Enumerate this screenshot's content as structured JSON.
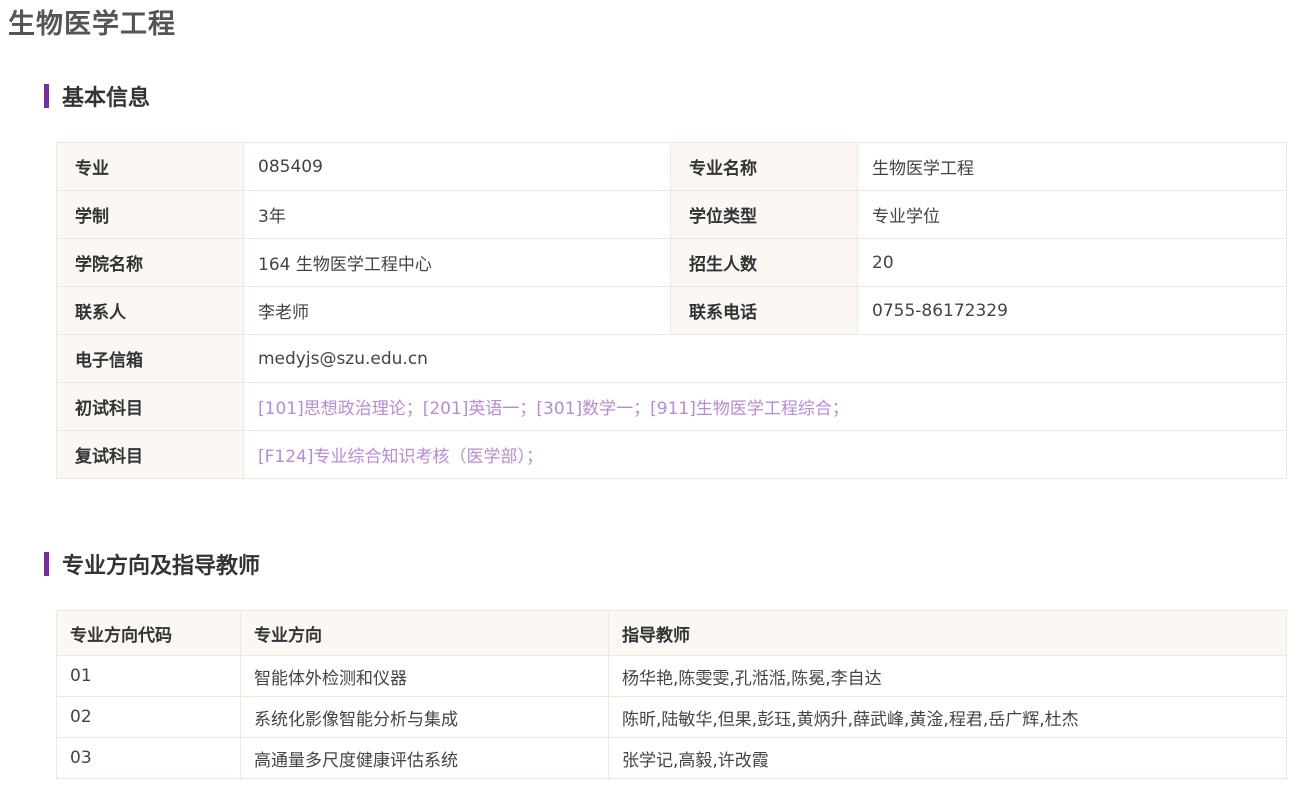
{
  "page_title": "生物医学工程",
  "sections": {
    "basic_info": "基本信息",
    "directions": "专业方向及指导教师"
  },
  "basic_info": {
    "major_label": "专业",
    "major_value": "085409",
    "major_name_label": "专业名称",
    "major_name_value": "生物医学工程",
    "duration_label": "学制",
    "duration_value": "3年",
    "degree_type_label": "学位类型",
    "degree_type_value": "专业学位",
    "college_label": "学院名称",
    "college_value": "164 生物医学工程中心",
    "enrollment_label": "招生人数",
    "enrollment_value": "20",
    "contact_label": "联系人",
    "contact_value": "李老师",
    "phone_label": "联系电话",
    "phone_value": "0755-86172329",
    "email_label": "电子信箱",
    "email_value": "medyjs@szu.edu.cn",
    "prelim_label": "初试科目",
    "prelim_value": "[101]思想政治理论；[201]英语一；[301]数学一；[911]生物医学工程综合；",
    "retest_label": "复试科目",
    "retest_value": "[F124]专业综合知识考核（医学部）；"
  },
  "directions_table": {
    "headers": [
      "专业方向代码",
      "专业方向",
      "指导教师"
    ],
    "rows": [
      [
        "01",
        "智能体外检测和仪器",
        "杨华艳,陈雯雯,孔湉湉,陈冕,李自达"
      ],
      [
        "02",
        "系统化影像智能分析与集成",
        "陈昕,陆敏华,但果,彭珏,黄炳升,薛武峰,黄淦,程君,岳广辉,杜杰"
      ],
      [
        "03",
        "高通量多尺度健康评估系统",
        "张学记,高毅,许改霞"
      ]
    ]
  },
  "colors": {
    "accent": "#7b2ea3",
    "link": "#b88ad8",
    "border": "#efe6dc",
    "label_bg": "#fbf8f4"
  }
}
